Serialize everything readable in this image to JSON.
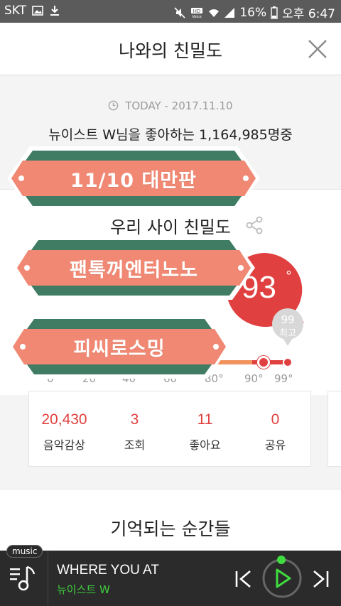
{
  "status_bar": {
    "carrier": "SKT",
    "battery": "16%",
    "time": "오후 6:47",
    "hd_voice": "HD Voice"
  },
  "header": {
    "title": "나와의 친밀도",
    "close_icon": "close-icon"
  },
  "date": {
    "icon": "clock-icon",
    "text": "TODAY - 2017.11.10"
  },
  "fans_text": "뉴이스트 W님을 좋아하는 1,164,985명중",
  "closeness": {
    "title": "우리 사이 친밀도",
    "share_icon": "share-icon",
    "temperature": "93",
    "degree": "°",
    "best_value": "99",
    "best_label": "최고",
    "level": 93,
    "best_level": 99,
    "gauge_max": 99,
    "ticks": [
      "0",
      "20",
      "40",
      "60",
      "80°",
      "90°",
      "99°"
    ]
  },
  "ribbons": [
    {
      "label": "11/10 대만판"
    },
    {
      "label": "팬톡꺼엔터노노"
    },
    {
      "label": "피씨로스밍"
    }
  ],
  "stats": [
    {
      "value": "20,430",
      "label": "음악감상"
    },
    {
      "value": "3",
      "label": "조회"
    },
    {
      "value": "11",
      "label": "좋아요"
    },
    {
      "value": "0",
      "label": "공유"
    }
  ],
  "moments_title": "기억되는 순간들",
  "player": {
    "badge": "music",
    "song_title": "WHERE YOU AT",
    "artist": "뉴이스트 W"
  },
  "colors": {
    "accent_red": "#e0403f",
    "ribbon_coral": "#f08873",
    "ribbon_green": "#3f7c63",
    "player_green": "#3fcf3f"
  }
}
